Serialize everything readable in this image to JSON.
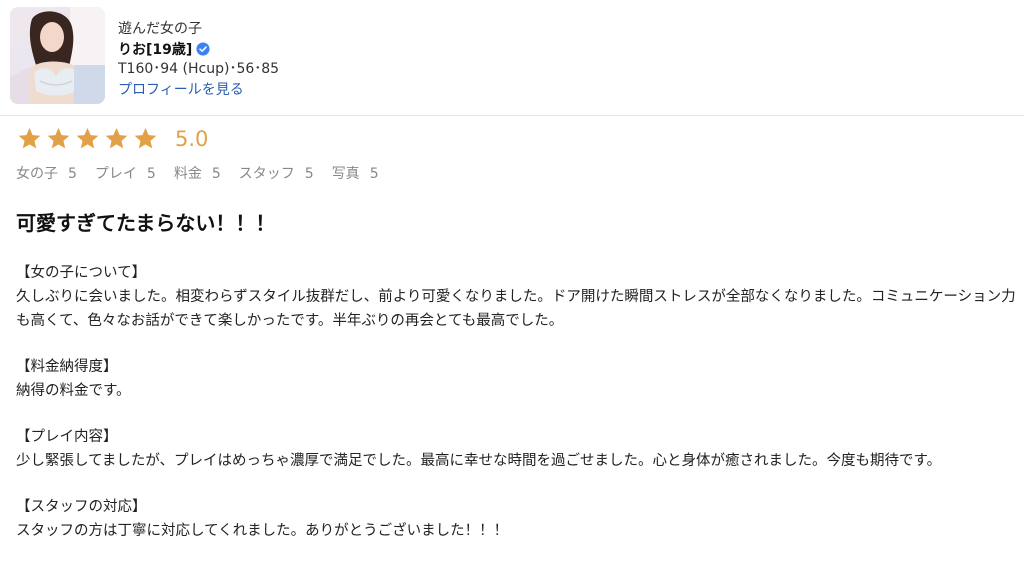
{
  "profile": {
    "label": "遊んだ女の子",
    "name": "りお[19歳]",
    "stats": "T160･94 (Hcup)･56･85",
    "profile_link": "プロフィールを見る"
  },
  "rating": {
    "stars": 5,
    "max_stars": 5,
    "score": "5.0",
    "star_color": "#e3a047",
    "subscores": [
      {
        "label": "女の子",
        "value": "5"
      },
      {
        "label": "プレイ",
        "value": "5"
      },
      {
        "label": "料金",
        "value": "5"
      },
      {
        "label": "スタッフ",
        "value": "5"
      },
      {
        "label": "写真",
        "value": "5"
      }
    ]
  },
  "review": {
    "title": "可愛すぎてたまらない！！！",
    "sections": [
      {
        "heading": "【女の子について】",
        "text": "久しぶりに会いました。相変わらずスタイル抜群だし、前より可愛くなりました。ドア開けた瞬間ストレスが全部なくなりました。コミュニケーション力も高くて、色々なお話ができて楽しかったです。半年ぶりの再会とても最高でした。"
      },
      {
        "heading": "【料金納得度】",
        "text": "納得の料金です。"
      },
      {
        "heading": "【プレイ内容】",
        "text": "少し緊張してましたが、プレイはめっちゃ濃厚で満足でした。最高に幸せな時間を過ごせました。心と身体が癒されました。今度も期待です。"
      },
      {
        "heading": "【スタッフの対応】",
        "text": "スタッフの方は丁寧に対応してくれました。ありがとうございました！！！"
      }
    ]
  }
}
